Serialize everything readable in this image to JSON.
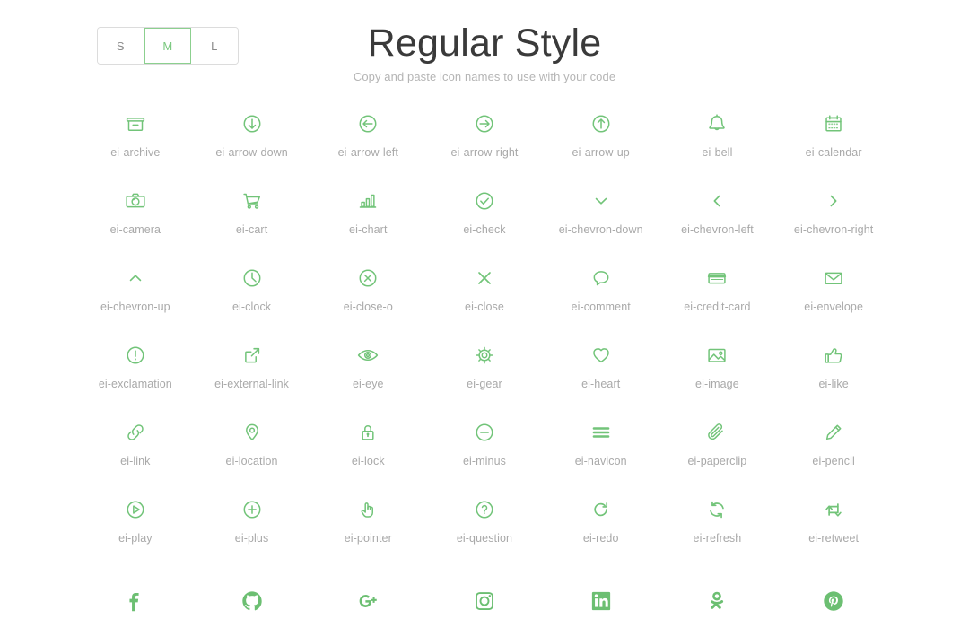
{
  "header": {
    "title": "Regular Style",
    "subtitle": "Copy and paste icon names to use with your code"
  },
  "size_switcher": {
    "options": [
      {
        "label": "S",
        "active": false
      },
      {
        "label": "M",
        "active": true
      },
      {
        "label": "L",
        "active": false
      }
    ]
  },
  "colors": {
    "icon_green": "#72c479",
    "label_gray": "#a9a9a9",
    "title_dark": "#3a3a3a",
    "subtitle_gray": "#b5b5b5",
    "border_gray": "#dcdcdc",
    "active_green": "#79c87e"
  },
  "icons": [
    {
      "name": "ei-archive",
      "icon": "archive-icon"
    },
    {
      "name": "ei-arrow-down",
      "icon": "arrow-down-circle-icon"
    },
    {
      "name": "ei-arrow-left",
      "icon": "arrow-left-circle-icon"
    },
    {
      "name": "ei-arrow-right",
      "icon": "arrow-right-circle-icon"
    },
    {
      "name": "ei-arrow-up",
      "icon": "arrow-up-circle-icon"
    },
    {
      "name": "ei-bell",
      "icon": "bell-icon"
    },
    {
      "name": "ei-calendar",
      "icon": "calendar-icon"
    },
    {
      "name": "ei-camera",
      "icon": "camera-icon"
    },
    {
      "name": "ei-cart",
      "icon": "cart-icon"
    },
    {
      "name": "ei-chart",
      "icon": "chart-icon"
    },
    {
      "name": "ei-check",
      "icon": "check-circle-icon"
    },
    {
      "name": "ei-chevron-down",
      "icon": "chevron-down-icon"
    },
    {
      "name": "ei-chevron-left",
      "icon": "chevron-left-icon"
    },
    {
      "name": "ei-chevron-right",
      "icon": "chevron-right-icon"
    },
    {
      "name": "ei-chevron-up",
      "icon": "chevron-up-icon"
    },
    {
      "name": "ei-clock",
      "icon": "clock-icon"
    },
    {
      "name": "ei-close-o",
      "icon": "close-circle-icon"
    },
    {
      "name": "ei-close",
      "icon": "close-icon"
    },
    {
      "name": "ei-comment",
      "icon": "comment-icon"
    },
    {
      "name": "ei-credit-card",
      "icon": "credit-card-icon"
    },
    {
      "name": "ei-envelope",
      "icon": "envelope-icon"
    },
    {
      "name": "ei-exclamation",
      "icon": "exclamation-circle-icon"
    },
    {
      "name": "ei-external-link",
      "icon": "external-link-icon"
    },
    {
      "name": "ei-eye",
      "icon": "eye-icon"
    },
    {
      "name": "ei-gear",
      "icon": "gear-icon"
    },
    {
      "name": "ei-heart",
      "icon": "heart-icon"
    },
    {
      "name": "ei-image",
      "icon": "image-icon"
    },
    {
      "name": "ei-like",
      "icon": "thumbs-up-icon"
    },
    {
      "name": "ei-link",
      "icon": "link-icon"
    },
    {
      "name": "ei-location",
      "icon": "location-pin-icon"
    },
    {
      "name": "ei-lock",
      "icon": "lock-icon"
    },
    {
      "name": "ei-minus",
      "icon": "minus-circle-icon"
    },
    {
      "name": "ei-navicon",
      "icon": "navicon-hamburger-icon"
    },
    {
      "name": "ei-paperclip",
      "icon": "paperclip-icon"
    },
    {
      "name": "ei-pencil",
      "icon": "pencil-icon"
    },
    {
      "name": "ei-play",
      "icon": "play-circle-icon"
    },
    {
      "name": "ei-plus",
      "icon": "plus-circle-icon"
    },
    {
      "name": "ei-pointer",
      "icon": "pointer-hand-icon"
    },
    {
      "name": "ei-question",
      "icon": "question-circle-icon"
    },
    {
      "name": "ei-redo",
      "icon": "redo-icon"
    },
    {
      "name": "ei-refresh",
      "icon": "refresh-icon"
    },
    {
      "name": "ei-retweet",
      "icon": "retweet-icon"
    }
  ],
  "social_icons": [
    {
      "icon": "facebook-icon"
    },
    {
      "icon": "github-icon"
    },
    {
      "icon": "google-plus-icon"
    },
    {
      "icon": "instagram-icon"
    },
    {
      "icon": "linkedin-icon"
    },
    {
      "icon": "odnoklassniki-icon"
    },
    {
      "icon": "pinterest-icon"
    }
  ]
}
